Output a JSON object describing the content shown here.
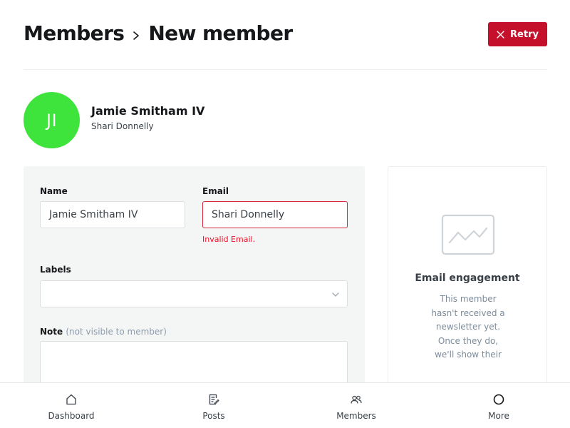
{
  "breadcrumb": {
    "parent": "Members",
    "current": "New member"
  },
  "header": {
    "retry_label": "Retry"
  },
  "member": {
    "initials": "JI",
    "name": "Jamie Smitham IV",
    "email": "Shari Donnelly",
    "avatar_color": "#3ee33b"
  },
  "form": {
    "name_label": "Name",
    "name_value": "Jamie Smitham IV",
    "email_label": "Email",
    "email_value": "Shari Donnelly",
    "email_error": "Invalid Email.",
    "labels_label": "Labels",
    "labels_value": "",
    "note_label": "Note",
    "note_hint": "(not visible to member)",
    "note_value": ""
  },
  "engagement": {
    "title": "Email engagement",
    "text": "This member hasn't received a newsletter yet. Once they do, we'll show their"
  },
  "nav": [
    {
      "label": "Dashboard",
      "icon": "home-icon"
    },
    {
      "label": "Posts",
      "icon": "posts-icon"
    },
    {
      "label": "Members",
      "icon": "members-icon"
    },
    {
      "label": "More",
      "icon": "more-icon"
    }
  ],
  "colors": {
    "accent": "#c5102b",
    "error": "#f50b23",
    "avatar": "#3ee33b"
  }
}
